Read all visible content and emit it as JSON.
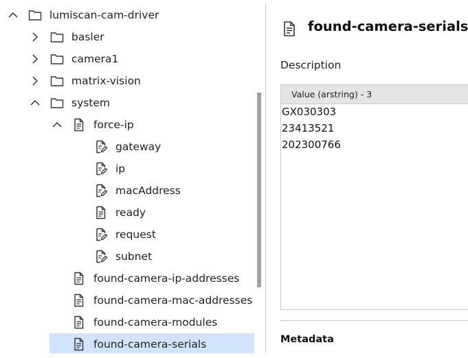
{
  "tree": {
    "items": [
      {
        "label": "lumiscan-cam-driver",
        "icon": "folder-icon",
        "chevron": "expanded"
      },
      {
        "label": "basler",
        "icon": "folder-icon",
        "chevron": "collapsed"
      },
      {
        "label": "camera1",
        "icon": "folder-icon",
        "chevron": "collapsed"
      },
      {
        "label": "matrix-vision",
        "icon": "folder-icon",
        "chevron": "collapsed"
      },
      {
        "label": "system",
        "icon": "folder-icon",
        "chevron": "expanded"
      },
      {
        "label": "force-ip",
        "icon": "document-icon",
        "chevron": "expanded"
      },
      {
        "label": "gateway",
        "icon": "editable-document-icon",
        "chevron": "none"
      },
      {
        "label": "ip",
        "icon": "editable-document-icon",
        "chevron": "none"
      },
      {
        "label": "macAddress",
        "icon": "editable-document-icon",
        "chevron": "none"
      },
      {
        "label": "ready",
        "icon": "document-icon",
        "chevron": "none"
      },
      {
        "label": "request",
        "icon": "editable-document-icon",
        "chevron": "none"
      },
      {
        "label": "subnet",
        "icon": "editable-document-icon",
        "chevron": "none"
      },
      {
        "label": "found-camera-ip-addresses",
        "icon": "document-icon",
        "chevron": "none"
      },
      {
        "label": "found-camera-mac-addresses",
        "icon": "document-icon",
        "chevron": "none"
      },
      {
        "label": "found-camera-modules",
        "icon": "document-icon",
        "chevron": "none"
      },
      {
        "label": "found-camera-serials",
        "icon": "document-icon",
        "chevron": "none",
        "selected": true
      }
    ]
  },
  "detail": {
    "title": "found-camera-serials",
    "title_icon": "document-icon",
    "description_label": "Description",
    "value_header": "Value (arstring) - 3",
    "values": [
      "GX030303",
      "23413521",
      "202300766"
    ],
    "metadata_label": "Metadata"
  },
  "colors": {
    "selection": "#d1e4fc",
    "header_bg": "#e4e4e4",
    "border": "#c8c8c8",
    "icon_stroke": "#333333"
  }
}
